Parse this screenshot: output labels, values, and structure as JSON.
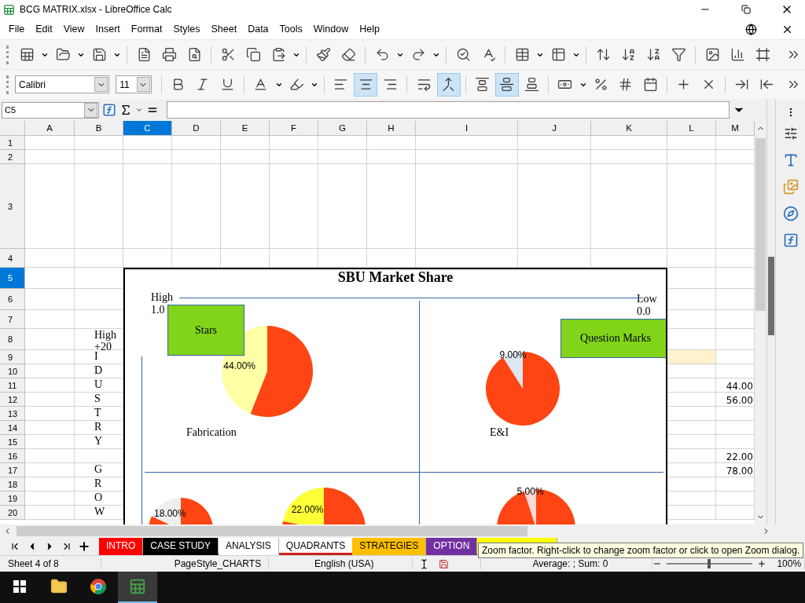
{
  "window": {
    "title": "BCG MATRIX.xlsx - LibreOffice Calc"
  },
  "menu": [
    "File",
    "Edit",
    "View",
    "Insert",
    "Format",
    "Styles",
    "Sheet",
    "Data",
    "Tools",
    "Window",
    "Help"
  ],
  "format_toolbar": {
    "font_name": "Calibri",
    "font_size": "11",
    "buttons": [
      {
        "kind": "bold",
        "on": false
      },
      {
        "kind": "italic",
        "on": false
      },
      {
        "kind": "underline",
        "on": false
      },
      {
        "kind": "font-color"
      },
      {
        "kind": "highlight"
      },
      {
        "kind": "align-left",
        "on": false
      },
      {
        "kind": "align-center",
        "on": true
      },
      {
        "kind": "align-right",
        "on": false
      },
      {
        "kind": "wrap",
        "on": false
      },
      {
        "kind": "merge",
        "on": true
      },
      {
        "kind": "align-top",
        "on": false
      },
      {
        "kind": "align-middle",
        "on": true
      },
      {
        "kind": "align-bottom",
        "on": false
      },
      {
        "kind": "currency"
      },
      {
        "kind": "percent"
      },
      {
        "kind": "number"
      },
      {
        "kind": "date"
      },
      {
        "kind": "add-decimal"
      },
      {
        "kind": "delete-decimal"
      },
      {
        "kind": "indent"
      },
      {
        "kind": "outdent"
      }
    ]
  },
  "formula_bar": {
    "name_box": "C5"
  },
  "sheet": {
    "columns": [
      {
        "label": "A",
        "selected": false
      },
      {
        "label": "B",
        "selected": false
      },
      {
        "label": "C",
        "selected": true
      },
      {
        "label": "D",
        "selected": false
      },
      {
        "label": "E",
        "selected": false
      },
      {
        "label": "F",
        "selected": false
      },
      {
        "label": "G",
        "selected": false
      },
      {
        "label": "H",
        "selected": false
      },
      {
        "label": "I",
        "selected": false
      },
      {
        "label": "J",
        "selected": false
      },
      {
        "label": "K",
        "selected": false
      },
      {
        "label": "L",
        "selected": false
      },
      {
        "label": "M",
        "selected": false
      }
    ],
    "rows": [
      {
        "label": "1",
        "selected": false
      },
      {
        "label": "2",
        "selected": false
      },
      {
        "label": "3",
        "selected": false
      },
      {
        "label": "4",
        "selected": false
      },
      {
        "label": "5",
        "selected": true
      },
      {
        "label": "6",
        "selected": false
      },
      {
        "label": "7",
        "selected": false
      },
      {
        "label": "8",
        "selected": false,
        "cells": {
          "B": {
            "text": "High\n+20"
          }
        }
      },
      {
        "label": "9",
        "selected": false,
        "cells": {
          "B": {
            "text": "I"
          },
          "L": {
            "highlighted": true
          }
        }
      },
      {
        "label": "10",
        "selected": false,
        "cells": {
          "B": {
            "text": "D"
          }
        }
      },
      {
        "label": "11",
        "selected": false,
        "cells": {
          "B": {
            "text": "U"
          },
          "M": {
            "text": "44.00"
          }
        }
      },
      {
        "label": "12",
        "selected": false,
        "cells": {
          "B": {
            "text": "S"
          },
          "M": {
            "text": "56.00"
          }
        }
      },
      {
        "label": "13",
        "selected": false,
        "cells": {
          "B": {
            "text": "T"
          }
        }
      },
      {
        "label": "14",
        "selected": false,
        "cells": {
          "B": {
            "text": "R"
          }
        }
      },
      {
        "label": "15",
        "selected": false,
        "cells": {
          "B": {
            "text": "Y"
          }
        }
      },
      {
        "label": "16",
        "selected": false,
        "cells": {
          "M": {
            "text": "22.00"
          }
        }
      },
      {
        "label": "17",
        "selected": false,
        "cells": {
          "B": {
            "text": "G"
          },
          "M": {
            "text": "78.00"
          }
        }
      },
      {
        "label": "18",
        "selected": false,
        "cells": {
          "B": {
            "text": "R"
          }
        }
      },
      {
        "label": "19",
        "selected": false,
        "cells": {
          "B": {
            "text": "O"
          }
        }
      },
      {
        "label": "20",
        "selected": false,
        "cells": {
          "B": {
            "text": "W"
          }
        }
      }
    ]
  },
  "chart": {
    "title": "SBU Market Share",
    "top_axis": {
      "left_label": "High",
      "left_value": "1.0",
      "right_label": "Low",
      "right_value": "0.0"
    },
    "quadrant_labels": [
      "Stars",
      "Question Marks"
    ],
    "pies": [
      {
        "label": "Fabrication",
        "chart_data": {
          "type": "pie",
          "values": [
            44,
            56
          ],
          "colors": [
            "#ffffa6",
            "#ff4513"
          ],
          "value_labels": [
            "44.00%",
            null
          ]
        }
      },
      {
        "label": "E&I",
        "chart_data": {
          "type": "pie",
          "values": [
            9,
            91
          ],
          "colors": [
            "#dee6ef",
            "#ff4513"
          ],
          "value_labels": [
            "9.00%",
            null
          ]
        }
      },
      {
        "chart_data": {
          "type": "pie",
          "values": [
            18,
            82
          ],
          "colors": [
            "#eeeeee",
            "#ff4513"
          ],
          "value_labels": [
            "18.00%",
            null
          ]
        }
      },
      {
        "chart_data": {
          "type": "pie",
          "values": [
            22,
            78
          ],
          "colors": [
            "#ffff38",
            "#ff4513"
          ],
          "value_labels": [
            "22.00%",
            null
          ]
        }
      },
      {
        "chart_data": {
          "type": "pie",
          "values": [
            5,
            95
          ],
          "colors": [
            "#ffd7d7",
            "#ff4513"
          ],
          "value_labels": [
            "5.00%",
            null
          ]
        }
      }
    ]
  },
  "sheet_tabs": [
    {
      "label": "INTRO",
      "color": "#ff0000",
      "selected": false
    },
    {
      "label": "CASE STUDY",
      "color": "#000000",
      "selected": false
    },
    {
      "label": "ANALYSIS",
      "color": "#ffffff",
      "selected": false
    },
    {
      "label": "QUADRANTS",
      "color": "#c9211e",
      "selected": true
    },
    {
      "label": "STRATEGIES",
      "color": "#ffbf00",
      "selected": false
    },
    {
      "label": "OPTION",
      "color": "#7030a0",
      "selected": false
    },
    {
      "color": "#ffff00",
      "selected": false
    }
  ],
  "tooltip": "Zoom factor. Right-click to change zoom factor or click to open Zoom dialog.",
  "status_bar": {
    "sheet": "Sheet 4 of 8",
    "page_style": "PageStyle_CHARTS",
    "language": "English (USA)",
    "sum": "Average: ; Sum: 0",
    "zoom": {
      "level": 0.5,
      "reading": "100%"
    }
  }
}
